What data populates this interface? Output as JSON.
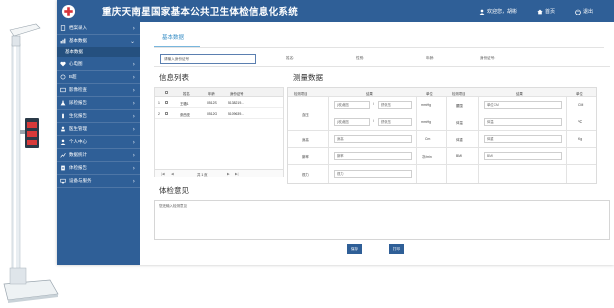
{
  "app": {
    "title": "重庆天南星国家基本公共卫生体检信息化系统",
    "welcome": "欢迎您，胡彬",
    "home": "首页",
    "exit": "退出",
    "brand_color": "#2f5f97"
  },
  "sidebar": {
    "items": [
      {
        "label": "档案录入",
        "icon": "doc-icon"
      },
      {
        "label": "基本数据",
        "icon": "data-icon",
        "active": true
      },
      {
        "label": "基本数据",
        "icon": "",
        "sub": true
      },
      {
        "label": "心电图",
        "icon": "heart-icon"
      },
      {
        "label": "B超",
        "icon": "scan-icon"
      },
      {
        "label": "影像检查",
        "icon": "image-icon"
      },
      {
        "label": "尿检报告",
        "icon": "flask-icon"
      },
      {
        "label": "生化报告",
        "icon": "test-icon"
      },
      {
        "label": "医生管理",
        "icon": "doctor-icon"
      },
      {
        "label": "个人中心",
        "icon": "user-icon"
      },
      {
        "label": "数据统计",
        "icon": "chart-icon"
      },
      {
        "label": "体检报告",
        "icon": "report-icon"
      },
      {
        "label": "设备与服务",
        "icon": "device-icon"
      }
    ]
  },
  "content": {
    "page_title": "基本数据",
    "search_placeholder": "请输入身份证号",
    "fields": {
      "name": "姓名:",
      "gender": "性别:",
      "age": "年龄:",
      "id_number": "身份证号:"
    }
  },
  "patient_list": {
    "title": "信息列表",
    "columns": [
      "",
      "",
      "姓名",
      "年龄",
      "身份证号"
    ],
    "rows": [
      {
        "no": "1",
        "name": "王璐1",
        "age": "0512S",
        "id": "5138219..."
      },
      {
        "no": "2",
        "name": "张西亚",
        "age": "0512G",
        "id": "5109639..."
      }
    ],
    "pager": "共 1 页"
  },
  "measure": {
    "title": "测量数据",
    "headers": [
      "检测项目",
      "结果",
      "单位",
      "检测项目",
      "结果",
      "单位"
    ],
    "rows": [
      {
        "label": "血压",
        "left_a": "(收)缩压",
        "sep": "/",
        "left_b": "舒张压",
        "unit1": "mmHg",
        "label2": "腰围",
        "val2": "单位CM",
        "unit2": "CM"
      },
      {
        "label": "",
        "left_a": "(收)缩压",
        "sep": "/",
        "left_b": "舒张压",
        "unit1": "mmHg",
        "label2": "体温",
        "val2": "体温",
        "unit2": "℃"
      },
      {
        "label": "身高",
        "left_a": "身高",
        "unit1": "Cm",
        "label2": "体重",
        "val2": "体重",
        "unit2": "Kg"
      },
      {
        "label": "脉率",
        "left_a": "脉率",
        "unit1": "次/min",
        "label2": "BMI",
        "val2": "BMI",
        "unit2": ""
      },
      {
        "label": "视力",
        "left_a": "视力",
        "unit1": "",
        "label2": "",
        "val2": "",
        "unit2": ""
      }
    ]
  },
  "opinion": {
    "title": "体检意见",
    "placeholder": "您还输入检测意见"
  },
  "buttons": {
    "save": "保存",
    "print": "打印"
  }
}
